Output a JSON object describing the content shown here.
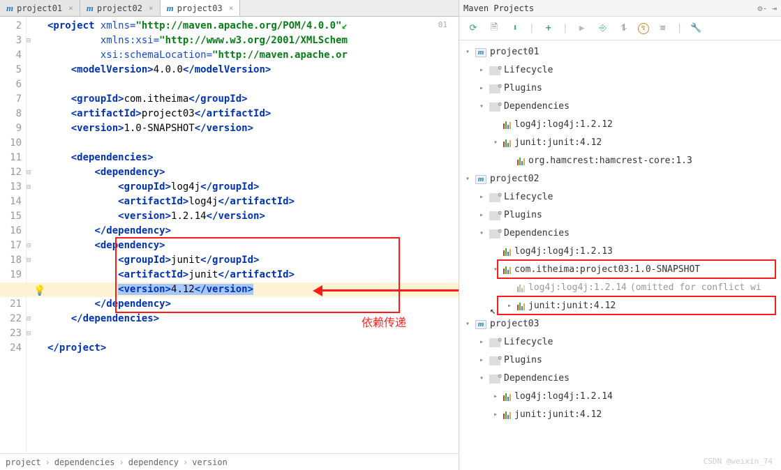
{
  "tabs": [
    "project01",
    "project02",
    "project03"
  ],
  "active_tab": 2,
  "page_indicator": "01",
  "annotation": "依赖传递",
  "watermark": "CSDN @weixin_74",
  "code": {
    "project_tag": "project",
    "xmlns": "xmlns=",
    "xmlns_val": "\"http://maven.apache.org/POM/4.0.0\"",
    "xmlns_xsi": "xmlns:xsi=",
    "xmlns_xsi_val": "\"http://www.w3.org/2001/XMLSchem",
    "schema_loc": "xsi:schemaLocation=",
    "schema_val": "\"http://maven.apache.or",
    "model_version": "4.0.0",
    "group_id": "com.itheima",
    "artifact_id": "project03",
    "version": "1.0-SNAPSHOT",
    "dep1_group": "log4j",
    "dep1_artifact": "log4j",
    "dep1_version": "1.2.14",
    "dep2_group": "junit",
    "dep2_artifact": "junit",
    "dep2_version": "4.12"
  },
  "breadcrumb": [
    "project",
    "dependencies",
    "dependency",
    "version"
  ],
  "maven_panel": {
    "title": "Maven Projects",
    "tree": {
      "p01": {
        "name": "project01",
        "lifecycle": "Lifecycle",
        "plugins": "Plugins",
        "deps": "Dependencies",
        "d1": "log4j:log4j:1.2.12",
        "d2": "junit:junit:4.12",
        "d2a": "org.hamcrest:hamcrest-core:1.3"
      },
      "p02": {
        "name": "project02",
        "lifecycle": "Lifecycle",
        "plugins": "Plugins",
        "deps": "Dependencies",
        "d1": "log4j:log4j:1.2.13",
        "d2": "com.itheima:project03:1.0-SNAPSHOT",
        "d2a": "log4j:log4j:1.2.14 ",
        "d2a_note": "(omitted for conflict wi",
        "d2b": "junit:junit:4.12"
      },
      "p03": {
        "name": "project03",
        "lifecycle": "Lifecycle",
        "plugins": "Plugins",
        "deps": "Dependencies",
        "d1": "log4j:log4j:1.2.14",
        "d2": "junit:junit:4.12"
      }
    }
  }
}
